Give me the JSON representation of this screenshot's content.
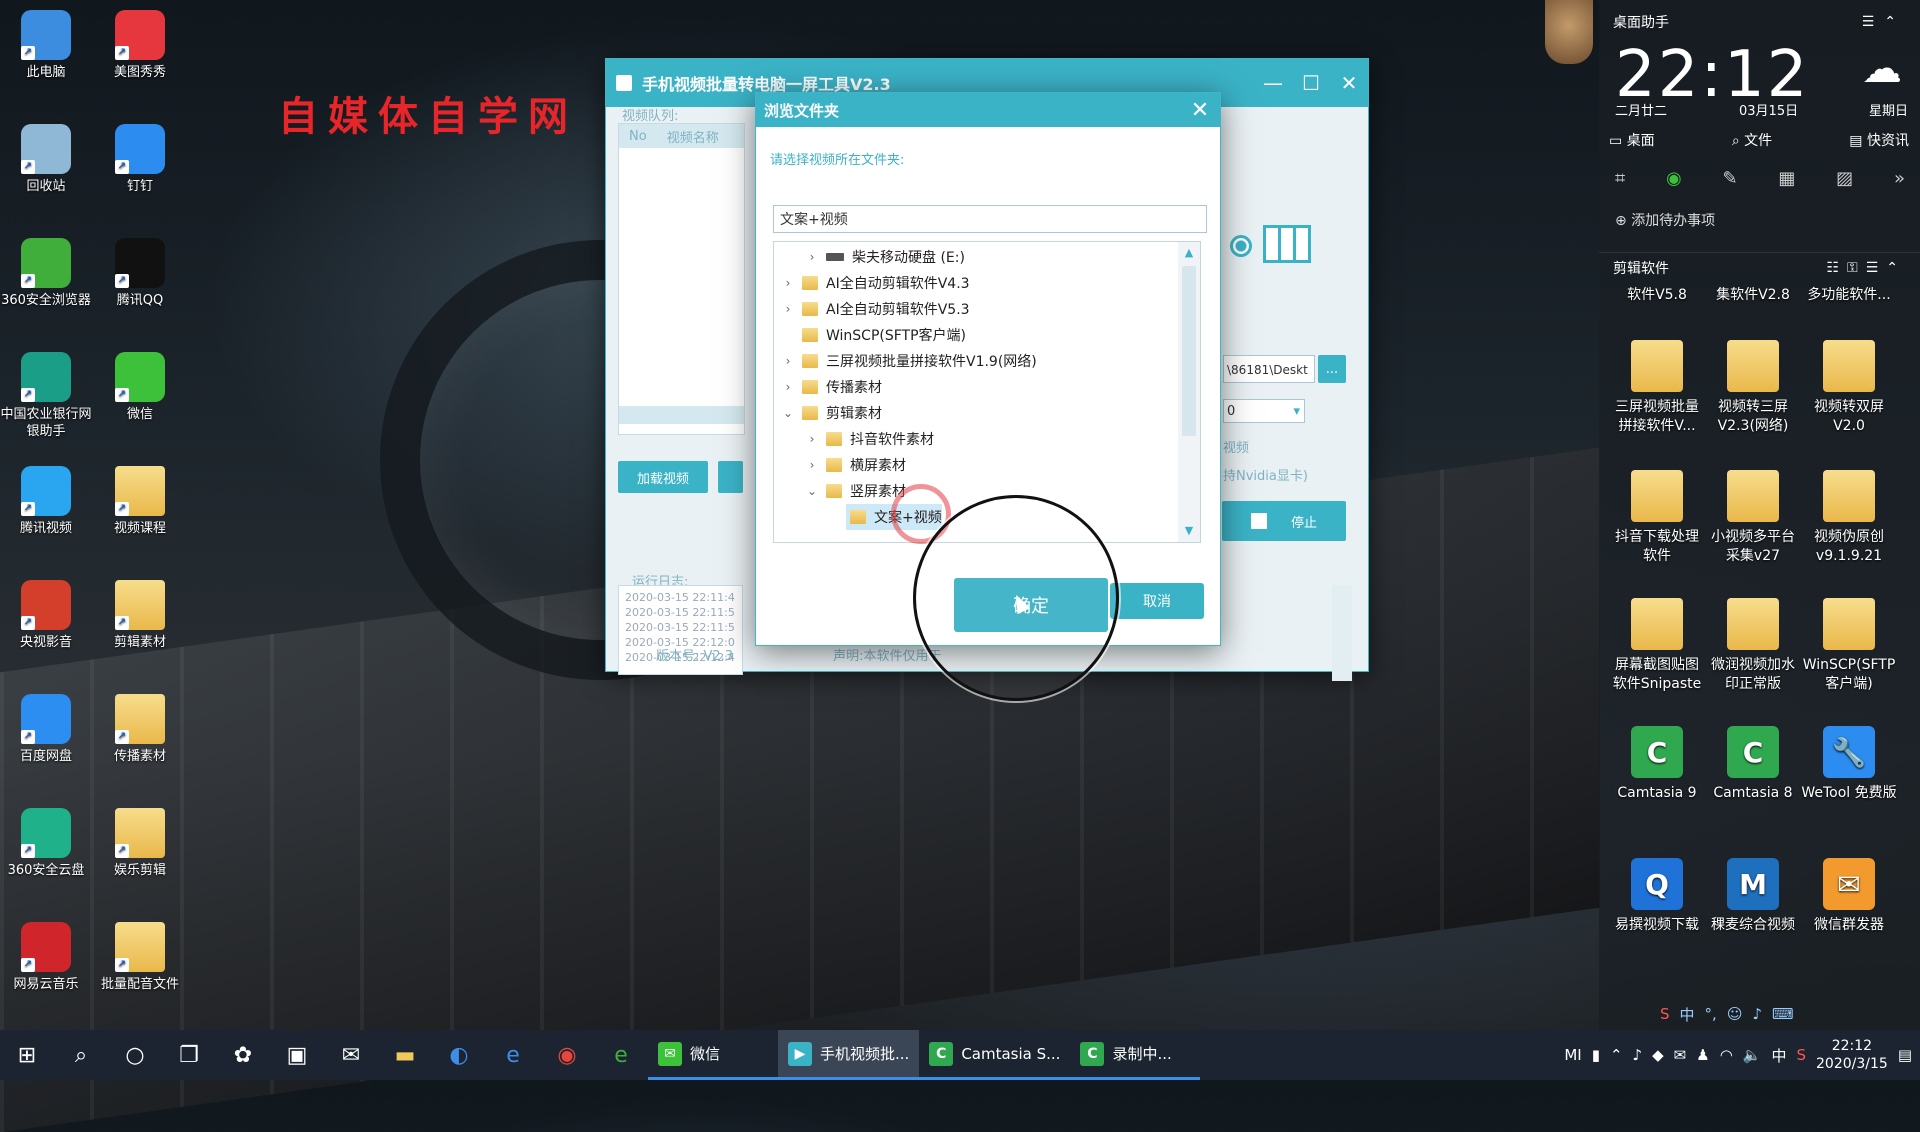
{
  "watermark": "自媒体自学网",
  "desktop_icons": [
    {
      "label": "此电脑",
      "icon": "computer-icon",
      "color": "#3c8de0"
    },
    {
      "label": "美图秀秀",
      "icon": "meitu-icon",
      "color": "#e6373f"
    },
    {
      "label": "回收站",
      "icon": "recycle-bin-icon",
      "color": "#8fb8d6"
    },
    {
      "label": "钉钉",
      "icon": "dingtalk-icon",
      "color": "#2d8cf0"
    },
    {
      "label": "360安全浏览器",
      "icon": "browser-360-icon",
      "color": "#3fae3a"
    },
    {
      "label": "腾讯QQ",
      "icon": "qq-icon",
      "color": "#111111"
    },
    {
      "label": "中国农业银行网银助手",
      "icon": "abc-bank-icon",
      "color": "#1a9e88"
    },
    {
      "label": "微信",
      "icon": "wechat-icon",
      "color": "#3ec13a"
    },
    {
      "label": "腾讯视频",
      "icon": "tencent-video-icon",
      "color": "#2aa5f0"
    },
    {
      "label": "视频课程",
      "icon": "folder-icon",
      "color": "#f0c85c"
    },
    {
      "label": "央视影音",
      "icon": "cctv-icon",
      "color": "#d33f2b"
    },
    {
      "label": "剪辑素材",
      "icon": "folder-icon",
      "color": "#f0c85c"
    },
    {
      "label": "百度网盘",
      "icon": "baidu-pan-icon",
      "color": "#2b8ef0"
    },
    {
      "label": "传播素材",
      "icon": "folder-icon",
      "color": "#f0c85c"
    },
    {
      "label": "360安全云盘",
      "icon": "cloud-360-icon",
      "color": "#1fb18a"
    },
    {
      "label": "娱乐剪辑",
      "icon": "folder-icon",
      "color": "#f0c85c"
    },
    {
      "label": "网易云音乐",
      "icon": "netease-music-icon",
      "color": "#d0262b"
    },
    {
      "label": "批量配音文件",
      "icon": "folder-icon",
      "color": "#f0c85c"
    }
  ],
  "app_window": {
    "title": "手机视频批量转电脑一屏工具V2.3",
    "queue_label": "视频队列:",
    "col_no": "No",
    "col_name": "视频名称",
    "load_button": "加载视频",
    "log_label": "运行日志:",
    "log_lines": [
      "2020-03-15 22:11:4",
      "2020-03-15 22:11:5",
      "2020-03-15 22:11:5",
      "2020-03-15 22:12:0",
      "2020-03-15 22:12:4"
    ],
    "path_value": "\\86181\\Deskt",
    "path_button": "...",
    "select_value": "0",
    "video_label": "视频",
    "nvidia_label": "持Nvidia显卡)",
    "stop_button": "停止",
    "version": "版本号: V2.3",
    "disclaimer": "声明:本软件仅用于"
  },
  "dialog": {
    "title": "浏览文件夹",
    "prompt": "请选择视频所在文件夹:",
    "path": "文案+视频",
    "ok": "确定",
    "cancel": "取消",
    "tree": [
      {
        "label": "柴夫移动硬盘 (E:)",
        "level": 1,
        "chev": "›",
        "type": "drive"
      },
      {
        "label": "AI全自动剪辑软件V4.3",
        "level": 0,
        "chev": "›",
        "type": "folder"
      },
      {
        "label": "AI全自动剪辑软件V5.3",
        "level": 0,
        "chev": "›",
        "type": "folder"
      },
      {
        "label": "WinSCP(SFTP客户端)",
        "level": 0,
        "chev": "",
        "type": "folder"
      },
      {
        "label": "三屏视频批量拼接软件V1.9(网络)",
        "level": 0,
        "chev": "›",
        "type": "folder"
      },
      {
        "label": "传播素材",
        "level": 0,
        "chev": "›",
        "type": "folder"
      },
      {
        "label": "剪辑素材",
        "level": 0,
        "chev": "⌄",
        "type": "folder"
      },
      {
        "label": "抖音软件素材",
        "level": 1,
        "chev": "›",
        "type": "folder"
      },
      {
        "label": "横屏素材",
        "level": 1,
        "chev": "›",
        "type": "folder"
      },
      {
        "label": "竖屏素材",
        "level": 1,
        "chev": "⌄",
        "type": "folder"
      },
      {
        "label": "文案+视频",
        "level": 2,
        "chev": "",
        "type": "folder",
        "selected": true
      }
    ]
  },
  "widget": {
    "title": "桌面助手",
    "time_h": "22",
    "time_m": "12",
    "lunar": "二月廿二",
    "date": "03月15日",
    "weekday": "星期日",
    "tabs": [
      "桌面",
      "文件",
      "快资讯"
    ],
    "todo": "添加待办事项",
    "section_title": "剪辑软件",
    "items": [
      {
        "label": "软件V5.8",
        "icon": "",
        "color": ""
      },
      {
        "label": "集软件V2.8",
        "icon": "",
        "color": ""
      },
      {
        "label": "多功能软件...",
        "icon": "",
        "color": ""
      },
      {
        "label": "三屏视频批量拼接软件V...",
        "icon": "folder-icon",
        "color": "#f0c85c"
      },
      {
        "label": "视频转三屏V2.3(网络)",
        "icon": "folder-icon",
        "color": "#f0c85c"
      },
      {
        "label": "视频转双屏V2.0",
        "icon": "folder-icon",
        "color": "#f0c85c"
      },
      {
        "label": "抖音下载处理软件",
        "icon": "folder-icon",
        "color": "#f0c85c"
      },
      {
        "label": "小视频多平台采集v27",
        "icon": "folder-icon",
        "color": "#f0c85c"
      },
      {
        "label": "视频伪原创v9.1.9.21",
        "icon": "folder-icon",
        "color": "#f0c85c"
      },
      {
        "label": "屏幕截图贴图软件Snipaste",
        "icon": "folder-icon",
        "color": "#f0c85c"
      },
      {
        "label": "微润视频加水印正常版",
        "icon": "folder-icon",
        "color": "#f0c85c"
      },
      {
        "label": "WinSCP(SFTP客户端)",
        "icon": "folder-icon",
        "color": "#f0c85c"
      },
      {
        "label": "Camtasia 9",
        "icon": "camtasia-icon",
        "color": "#2fa84f"
      },
      {
        "label": "Camtasia 8",
        "icon": "camtasia-icon",
        "color": "#2fa84f"
      },
      {
        "label": "WeTool 免费版",
        "icon": "wrench-icon",
        "color": "#2d8cf0"
      },
      {
        "label": "易撰视频下载",
        "icon": "search-q-icon",
        "color": "#1f73d8"
      },
      {
        "label": "稞麦综合视频",
        "icon": "m-icon",
        "color": "#1f6fbf"
      },
      {
        "label": "微信群发器",
        "icon": "chat-bubbles-icon",
        "color": "#f29a2e"
      }
    ]
  },
  "taskbar": {
    "apps": [
      {
        "label": "微信",
        "icon": "wechat-icon",
        "color": "#3ec13a",
        "glyph": "✉"
      },
      {
        "label": "手机视频批...",
        "icon": "app-icon",
        "color": "#3bb3c7",
        "glyph": "▶",
        "active": true
      },
      {
        "label": "Camtasia S...",
        "icon": "camtasia-icon",
        "color": "#2fa84f",
        "glyph": "C"
      },
      {
        "label": "录制中...",
        "icon": "camtasia-icon",
        "color": "#2fa84f",
        "glyph": "C"
      }
    ],
    "time": "22:12",
    "date": "2020/3/15",
    "ime": "中"
  }
}
